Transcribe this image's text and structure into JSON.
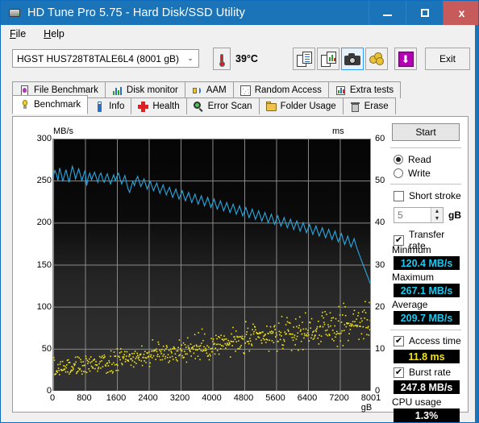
{
  "window": {
    "title": "HD Tune Pro 5.75 - Hard Disk/SSD Utility",
    "app_icon": "harddisk-icon",
    "minimize": "—",
    "maximize": "☐",
    "close": "x",
    "accent_color": "#1b74b8",
    "close_color": "#c75b5b"
  },
  "menu": {
    "items": [
      {
        "label": "File",
        "mnemonic": "F"
      },
      {
        "label": "Help",
        "mnemonic": "H"
      }
    ]
  },
  "toolbar": {
    "drive": "HGST HUS728T8TALE6L4 (8001 gB)",
    "drive_chevron": "⌄",
    "temperature": "39°C",
    "thermometer_icon": "thermometer-icon",
    "buttons": [
      {
        "name": "copy-text-button",
        "icon": "document-copy-icon"
      },
      {
        "name": "copy-graph-button",
        "icon": "document-chart-copy-icon"
      },
      {
        "name": "screenshot-button",
        "icon": "camera-icon",
        "selected": true
      },
      {
        "name": "donate-button",
        "icon": "coins-icon"
      },
      {
        "name": "save-button",
        "icon": "download-arrow-icon"
      }
    ],
    "exit_label": "Exit"
  },
  "tabs": {
    "row1": [
      {
        "label": "File Benchmark",
        "icon": "file-benchmark-icon",
        "active": false
      },
      {
        "label": "Disk monitor",
        "icon": "bar-chart-icon",
        "active": false
      },
      {
        "label": "AAM",
        "icon": "speaker-icon",
        "active": false
      },
      {
        "label": "Random Access",
        "icon": "random-dots-icon",
        "active": false
      },
      {
        "label": "Extra tests",
        "icon": "extra-chart-icon",
        "active": false
      }
    ],
    "row2": [
      {
        "label": "Benchmark",
        "icon": "lightbulb-icon",
        "active": true
      },
      {
        "label": "Info",
        "icon": "info-icon",
        "active": false
      },
      {
        "label": "Health",
        "icon": "red-cross-icon",
        "active": false
      },
      {
        "label": "Error Scan",
        "icon": "magnifier-icon",
        "active": false
      },
      {
        "label": "Folder Usage",
        "icon": "folder-icon",
        "active": false
      },
      {
        "label": "Erase",
        "icon": "trash-icon",
        "active": false
      }
    ]
  },
  "panel": {
    "start_label": "Start",
    "mode": {
      "read_label": "Read",
      "write_label": "Write",
      "selected": "Read"
    },
    "short_stroke": {
      "label": "Short stroke",
      "checked": false,
      "value": "5",
      "unit": "gB",
      "spinner_up": "▲",
      "spinner_down": "▼"
    },
    "transfer_rate": {
      "label": "Transfer rate",
      "checked": true,
      "minimum_label": "Minimum",
      "minimum_value": "120.4 MB/s",
      "maximum_label": "Maximum",
      "maximum_value": "267.1 MB/s",
      "average_label": "Average",
      "average_value": "209.7 MB/s"
    },
    "access_time": {
      "label": "Access time",
      "checked": true,
      "value": "11.8 ms"
    },
    "burst_rate": {
      "label": "Burst rate",
      "checked": true,
      "value": "247.8 MB/s"
    },
    "cpu_usage": {
      "label": "CPU usage",
      "value": "1.3%"
    },
    "checkmark": "✔",
    "colors": {
      "transfer_rate_line": "#29a8e0",
      "access_time_dots": "#f2e318",
      "value_text_cyan": "#19c9f2",
      "value_text_yellow": "#f2e318",
      "value_text_white": "#ffffff"
    }
  },
  "chart_data": {
    "type": "line",
    "title": "",
    "ylabel": "MB/s",
    "ylabel_right": "ms",
    "xlabel": "gB",
    "xlim": [
      0,
      8001
    ],
    "ylim": [
      0,
      300
    ],
    "ylim_right": [
      0,
      60
    ],
    "grid": true,
    "background": "#111111",
    "yticks": [
      0,
      50,
      100,
      150,
      200,
      250,
      300
    ],
    "yticks_right": [
      0,
      10,
      20,
      30,
      40,
      50,
      60
    ],
    "xticks": [
      0,
      800,
      1600,
      2400,
      3200,
      4000,
      4800,
      5600,
      6400,
      7200,
      8001
    ],
    "xtick_labels": [
      "0",
      "800",
      "1600",
      "2400",
      "3200",
      "4000",
      "4800",
      "5600",
      "6400",
      "7200",
      "8001 gB"
    ],
    "series": [
      {
        "name": "Transfer rate",
        "axis": "left",
        "unit": "MB/s",
        "color": "#29a8e0",
        "type": "line",
        "x": [
          0,
          40,
          80,
          120,
          160,
          200,
          240,
          280,
          320,
          360,
          400,
          440,
          480,
          520,
          560,
          600,
          640,
          680,
          720,
          760,
          800,
          840,
          880,
          920,
          960,
          1000,
          1040,
          1080,
          1120,
          1160,
          1200,
          1240,
          1280,
          1320,
          1360,
          1400,
          1440,
          1480,
          1520,
          1560,
          1600,
          1640,
          1680,
          1720,
          1760,
          1800,
          1840,
          1880,
          1920,
          1960,
          2000,
          2040,
          2080,
          2120,
          2160,
          2200,
          2240,
          2280,
          2320,
          2360,
          2400,
          2440,
          2480,
          2520,
          2560,
          2600,
          2640,
          2680,
          2720,
          2760,
          2800,
          2840,
          2880,
          2920,
          2960,
          3000,
          3040,
          3080,
          3120,
          3160,
          3200,
          3240,
          3280,
          3320,
          3360,
          3400,
          3440,
          3480,
          3520,
          3560,
          3600,
          3640,
          3680,
          3720,
          3760,
          3800,
          3840,
          3880,
          3920,
          3960,
          4000,
          4040,
          4080,
          4120,
          4160,
          4200,
          4240,
          4280,
          4320,
          4360,
          4400,
          4440,
          4480,
          4520,
          4560,
          4600,
          4640,
          4680,
          4720,
          4760,
          4800,
          4840,
          4880,
          4920,
          4960,
          5000,
          5040,
          5080,
          5120,
          5160,
          5200,
          5240,
          5280,
          5320,
          5360,
          5400,
          5440,
          5480,
          5520,
          5560,
          5600,
          5640,
          5680,
          5720,
          5760,
          5800,
          5840,
          5880,
          5920,
          5960,
          6000,
          6040,
          6080,
          6120,
          6160,
          6200,
          6240,
          6280,
          6320,
          6360,
          6400,
          6440,
          6480,
          6520,
          6560,
          6600,
          6640,
          6680,
          6720,
          6760,
          6800,
          6840,
          6880,
          6920,
          6960,
          7000,
          7040,
          7080,
          7120,
          7160,
          7200,
          7240,
          7280,
          7320,
          7360,
          7400,
          7440,
          7480,
          7520,
          7560,
          7600,
          7640,
          7680,
          7720,
          7760,
          7800,
          7840,
          7880,
          7920,
          7960,
          8001
        ],
        "y": [
          255,
          262,
          258,
          250,
          265,
          258,
          249,
          256,
          263,
          255,
          248,
          258,
          267,
          261,
          252,
          258,
          264,
          257,
          250,
          256,
          262,
          244,
          254,
          259,
          251,
          256,
          260,
          254,
          248,
          256,
          259,
          252,
          248,
          254,
          258,
          251,
          246,
          252,
          257,
          250,
          255,
          259,
          252,
          246,
          251,
          256,
          248,
          240,
          236,
          243,
          249,
          244,
          251,
          255,
          249,
          243,
          247,
          252,
          246,
          240,
          245,
          249,
          243,
          238,
          243,
          247,
          241,
          235,
          240,
          245,
          239,
          233,
          238,
          242,
          236,
          230,
          235,
          240,
          234,
          228,
          233,
          238,
          232,
          226,
          231,
          236,
          230,
          224,
          229,
          234,
          228,
          222,
          227,
          232,
          226,
          220,
          225,
          230,
          224,
          218,
          223,
          228,
          222,
          216,
          221,
          226,
          220,
          214,
          219,
          224,
          218,
          212,
          217,
          222,
          216,
          210,
          215,
          220,
          214,
          208,
          213,
          218,
          212,
          206,
          211,
          216,
          210,
          204,
          209,
          214,
          208,
          202,
          207,
          212,
          206,
          200,
          205,
          210,
          204,
          198,
          203,
          208,
          202,
          196,
          201,
          206,
          200,
          194,
          199,
          204,
          198,
          192,
          197,
          202,
          196,
          190,
          195,
          200,
          194,
          188,
          193,
          198,
          192,
          186,
          191,
          196,
          190,
          184,
          189,
          194,
          188,
          182,
          187,
          192,
          186,
          180,
          185,
          190,
          183,
          177,
          182,
          187,
          180,
          174,
          179,
          184,
          177,
          171,
          176,
          181,
          174,
          168,
          163,
          158,
          153,
          148,
          143,
          138,
          133,
          128,
          124,
          122,
          121,
          120.4
        ]
      },
      {
        "name": "Access time",
        "axis": "right",
        "unit": "ms",
        "color": "#f2e318",
        "type": "scatter",
        "average": 11.8,
        "range_ms": [
          4,
          22
        ],
        "note": "Scatter of ~600 random access samples; values rise gradually from ~5 ms near the start of the disk to ~18 ms near the end."
      }
    ]
  }
}
